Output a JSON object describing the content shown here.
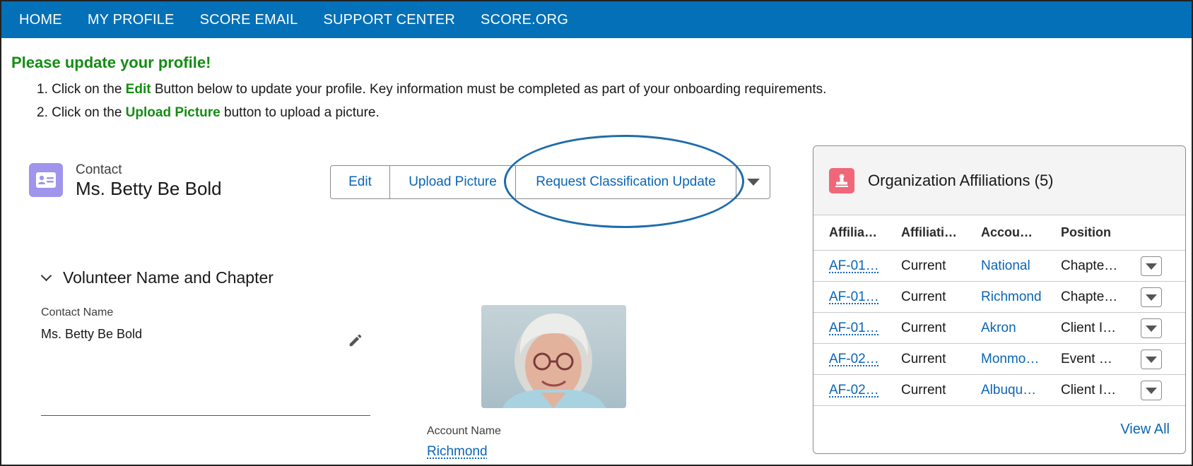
{
  "nav": {
    "items": [
      "HOME",
      "MY PROFILE",
      "SCORE EMAIL",
      "SUPPORT CENTER",
      "SCORE.ORG"
    ]
  },
  "instructions": {
    "headline": "Please update your profile!",
    "step1_prefix": "1. Click on the ",
    "step1_highlight": "Edit",
    "step1_suffix": " Button below to update your profile. Key information must be completed as part of your onboarding requirements.",
    "step2_prefix": "2. Click on the ",
    "step2_highlight": "Upload Picture",
    "step2_suffix": " button to upload a picture."
  },
  "record": {
    "type": "Contact",
    "name": "Ms. Betty Be Bold",
    "icon": "contact-card-icon"
  },
  "actions": {
    "edit": "Edit",
    "upload": "Upload Picture",
    "request": "Request Classification Update"
  },
  "section": {
    "title": "Volunteer Name and Chapter",
    "contact_name_label": "Contact Name",
    "contact_name_value": "Ms. Betty Be Bold",
    "account_name_label": "Account Name",
    "account_name_value": "Richmond"
  },
  "affiliations": {
    "title": "Organization Affiliations (5)",
    "columns": [
      "Affilia…",
      "Affiliati…",
      "Accou…",
      "Position"
    ],
    "rows": [
      {
        "id": "AF-01…",
        "status": "Current",
        "account": "National",
        "position": "Chapte…"
      },
      {
        "id": "AF-01…",
        "status": "Current",
        "account": "Richmond",
        "position": "Chapte…"
      },
      {
        "id": "AF-01…",
        "status": "Current",
        "account": "Akron",
        "position": "Client I…"
      },
      {
        "id": "AF-02…",
        "status": "Current",
        "account": "Monmo…",
        "position": "Event …"
      },
      {
        "id": "AF-02…",
        "status": "Current",
        "account": "Albuqu…",
        "position": "Client I…"
      }
    ],
    "view_all": "View All"
  },
  "colors": {
    "nav_bg": "#0470b8",
    "headline_green": "#148c14",
    "link_blue": "#0a65b5",
    "contact_icon_bg": "#a094ed",
    "card_icon_bg": "#f0677a",
    "ellipse": "#1f6cab"
  }
}
